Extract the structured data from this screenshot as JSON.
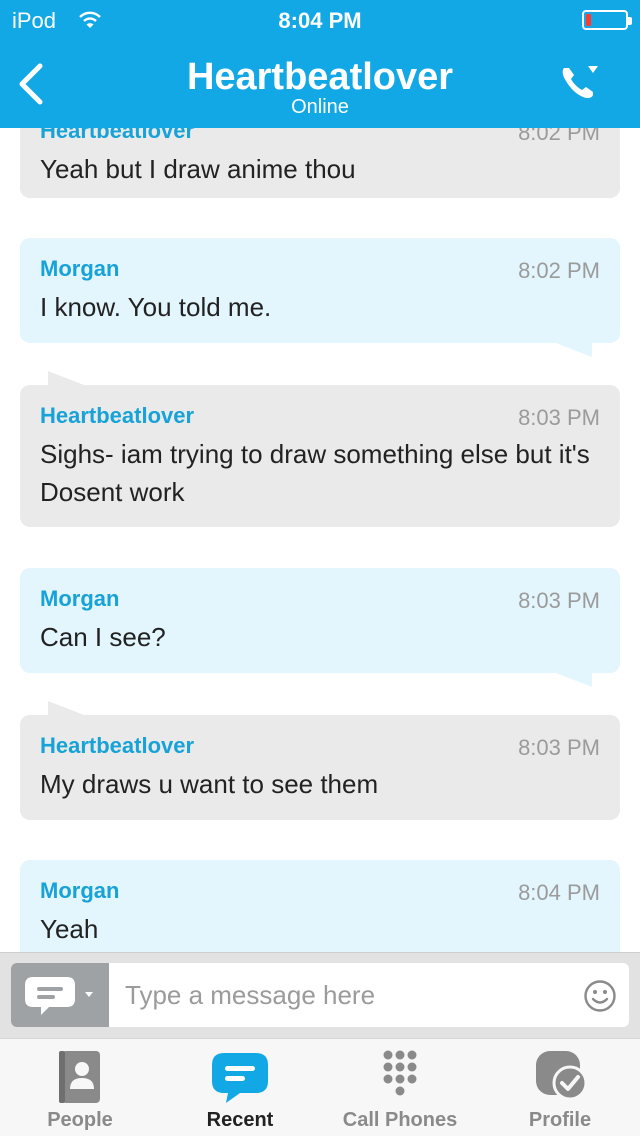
{
  "status_bar": {
    "carrier": "iPod",
    "time": "8:04 PM",
    "battery_level": 0.12
  },
  "header": {
    "title": "Heartbeatlover",
    "subtitle": "Online",
    "accent": "#12a8e6"
  },
  "messages": [
    {
      "direction": "in",
      "name": "Heartbeatlover",
      "time": "8:02 PM",
      "text": "Yeah but I draw anime thou"
    },
    {
      "direction": "out",
      "name": "Morgan",
      "time": "8:02 PM",
      "text": "I know. You told me."
    },
    {
      "direction": "in",
      "name": "Heartbeatlover",
      "time": "8:03 PM",
      "text": "Sighs- iam trying to draw something else but it's Dosent work"
    },
    {
      "direction": "out",
      "name": "Morgan",
      "time": "8:03 PM",
      "text": "Can I see?"
    },
    {
      "direction": "in",
      "name": "Heartbeatlover",
      "time": "8:03 PM",
      "text": "My draws u want to see them"
    },
    {
      "direction": "out",
      "name": "Morgan",
      "time": "8:04 PM",
      "text": "Yeah"
    }
  ],
  "composer": {
    "placeholder": "Type a message here",
    "value": ""
  },
  "tabs": [
    {
      "label": "People",
      "icon": "contacts-icon"
    },
    {
      "label": "Recent",
      "icon": "chat-bubble-icon",
      "active": true
    },
    {
      "label": "Call Phones",
      "icon": "dialpad-icon"
    },
    {
      "label": "Profile",
      "icon": "status-check-icon"
    }
  ]
}
